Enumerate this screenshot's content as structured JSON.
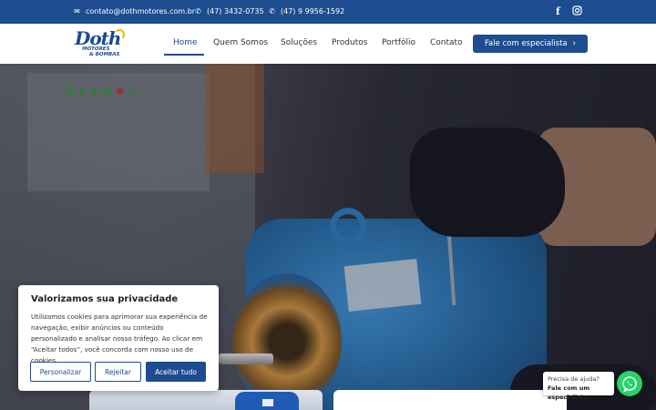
{
  "topbar": {
    "email": "contato@dothmotores.com.br",
    "phone1": "(47) 3432-0735",
    "phone2": "(47) 9 9956-1592",
    "email_icon": "mail-icon",
    "phone_icon": "whatsapp-icon",
    "social": [
      "facebook-icon",
      "instagram-icon"
    ]
  },
  "brand": {
    "logo_name": "Doth",
    "logo_sub1": "MOTORES",
    "logo_sub2": "& BOMBAS"
  },
  "nav": {
    "items": [
      "Home",
      "Quem Somos",
      "Soluções",
      "Produtos",
      "Portfólio",
      "Contato"
    ],
    "active": "Home",
    "cta_label": "Fale com especialista",
    "cta_icon": "chevron-right-icon"
  },
  "cookie": {
    "title": "Valorizamos sua privacidade",
    "body": "Utilizamos cookies para aprimorar sua experiência de navegação, exibir anúncios ou conteúdo personalizado e analisar nosso tráfego. Ao clicar em “Aceitar todos”, você concorda com nosso uso de cookies.",
    "btn_customize": "Personalizar",
    "btn_reject": "Rejeitar",
    "btn_accept": "Aceitar tudo"
  },
  "help": {
    "text": "Precisa de ajuda?",
    "bold": "Fale com um especialista",
    "icon": "whatsapp-icon"
  },
  "colors": {
    "primary": "#1d4d8f",
    "whatsapp": "#25d366",
    "logo_accent": "#f2b705"
  }
}
